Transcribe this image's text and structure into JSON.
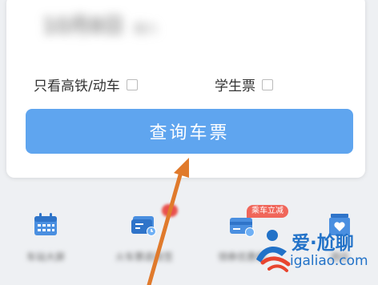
{
  "search_card": {
    "date_main": "10月8日",
    "date_sub": "周六",
    "option_hsr_label": "只看高铁/动车",
    "option_student_label": "学生票",
    "query_button_label": "查询车票"
  },
  "quick_links": {
    "items": [
      {
        "label": "车站大屏",
        "icon": "calendar-icon"
      },
      {
        "label": "火车票退改签",
        "icon": "ticket-icon"
      },
      {
        "label": "领券优惠券",
        "icon": "card-icon"
      },
      {
        "label": "酒店",
        "icon": "heart-box-icon"
      }
    ],
    "promo_badge": "乘车立减"
  },
  "watermark": {
    "cn_text": "爱·尬聊",
    "url_text": "igaliao.com"
  },
  "colors": {
    "primary_button": "#5fa5ef",
    "icon_blue": "#4a8fe0",
    "promo_red": "#f0665a",
    "arrow_orange": "#e07a2c",
    "watermark_blue": "#2272c8"
  }
}
